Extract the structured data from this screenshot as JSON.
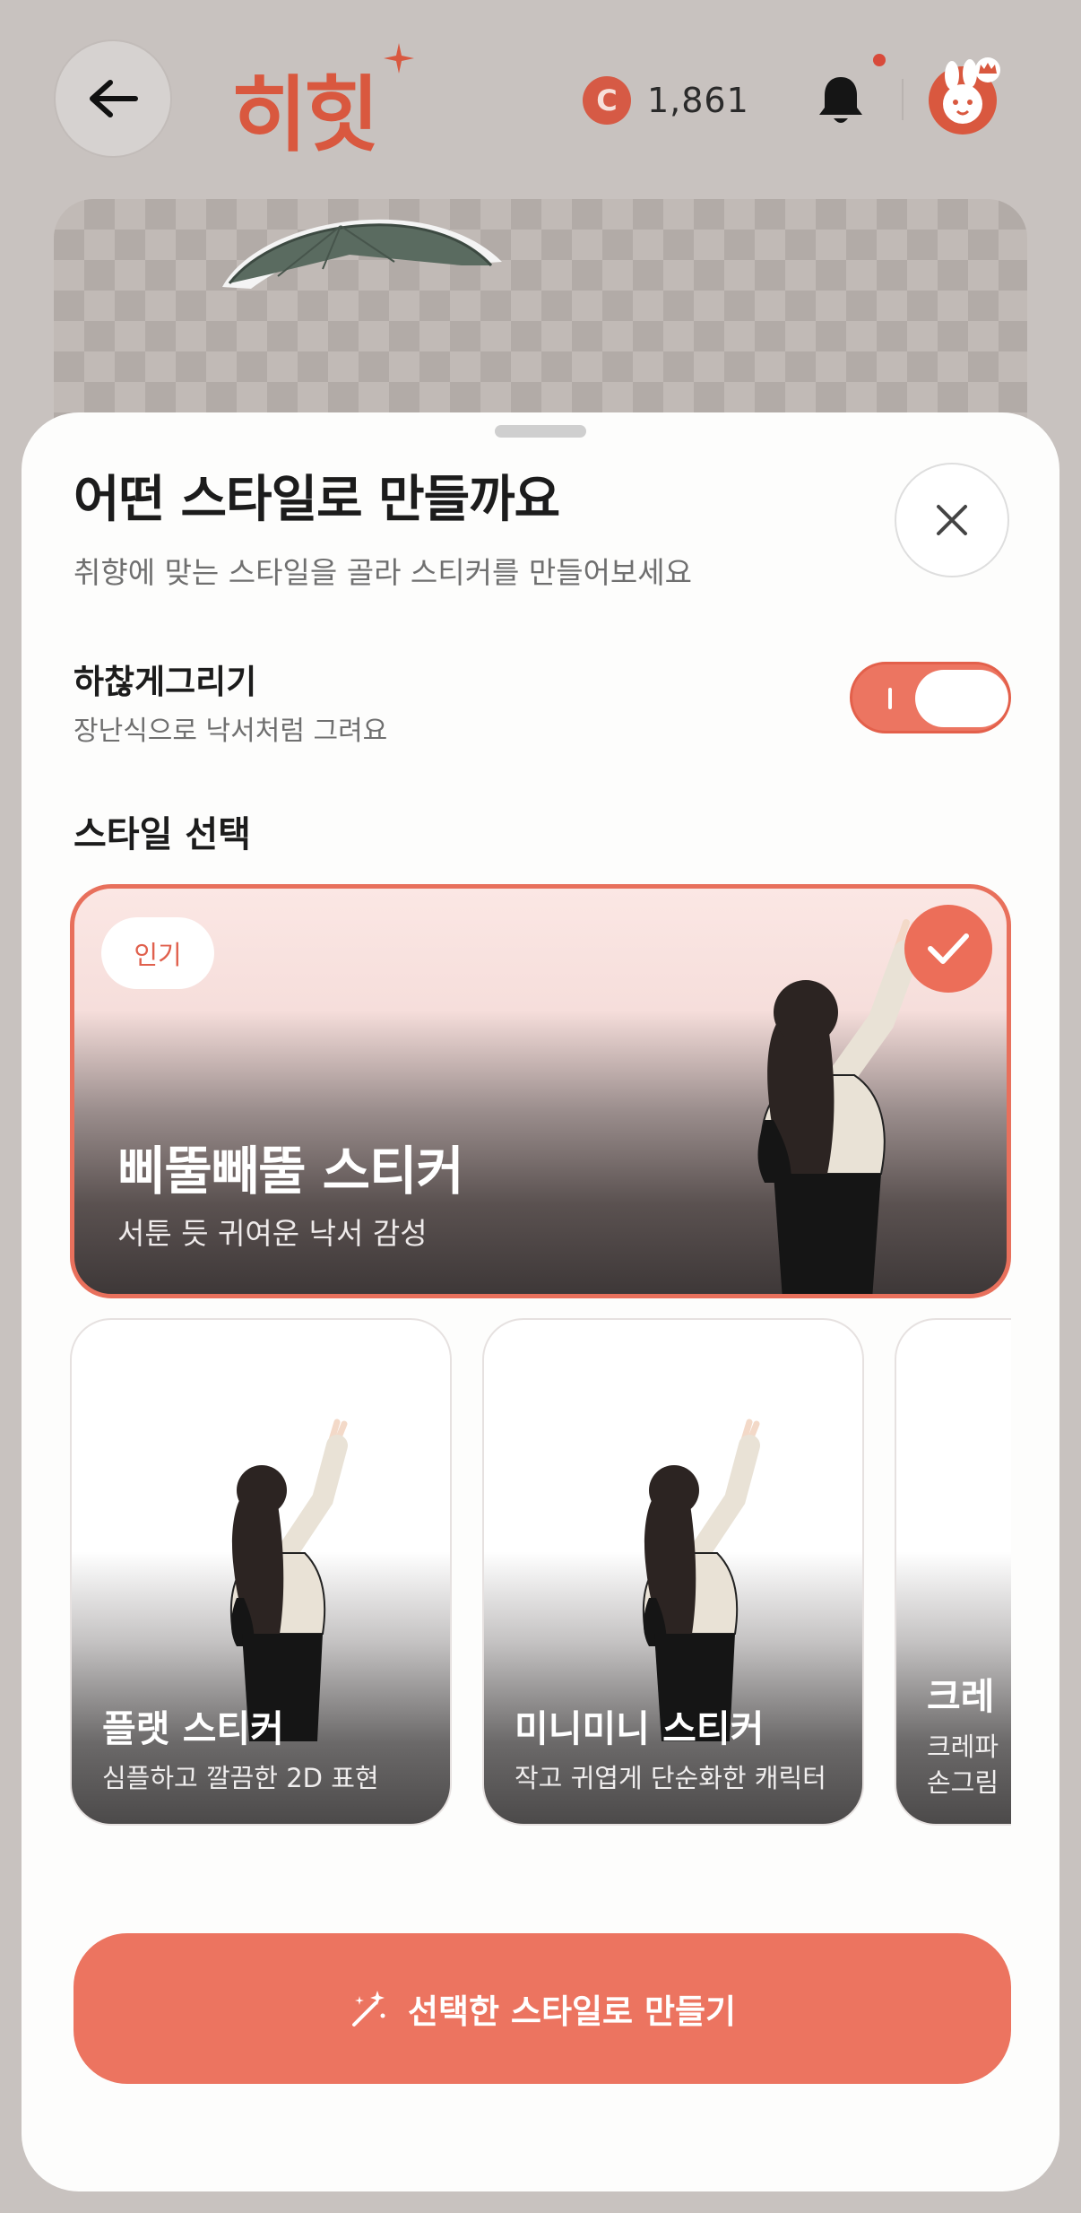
{
  "header": {
    "logo_text": "히힛",
    "coins": "1,861",
    "coin_symbol": "C"
  },
  "sheet": {
    "title": "어떤 스타일로 만들까요",
    "subtitle": "취향에 맞는 스타일을 골라 스티커를 만들어보세요",
    "toggle": {
      "title": "하찮게그리기",
      "subtitle": "장난식으로 낙서처럼 그려요",
      "on": true
    },
    "section_title": "스타일 선택",
    "featured": {
      "badge": "인기",
      "title": "삐뚤빼뚤 스티커",
      "subtitle": "서툰 듯 귀여운 낙서 감성",
      "selected": true
    },
    "styles": [
      {
        "title": "플랫 스티커",
        "subtitle": "심플하고 깔끔한 2D 표현"
      },
      {
        "title": "미니미니 스티커",
        "subtitle": "작고 귀엽게 단순화한 캐릭터"
      },
      {
        "title": "크레",
        "subtitle": "크레파\n손그림"
      }
    ],
    "cta_label": "선택한 스타일로 만들기"
  },
  "colors": {
    "accent": "#ec7460",
    "accent_dark": "#d9583f",
    "backdrop": "#c8c2bf"
  }
}
